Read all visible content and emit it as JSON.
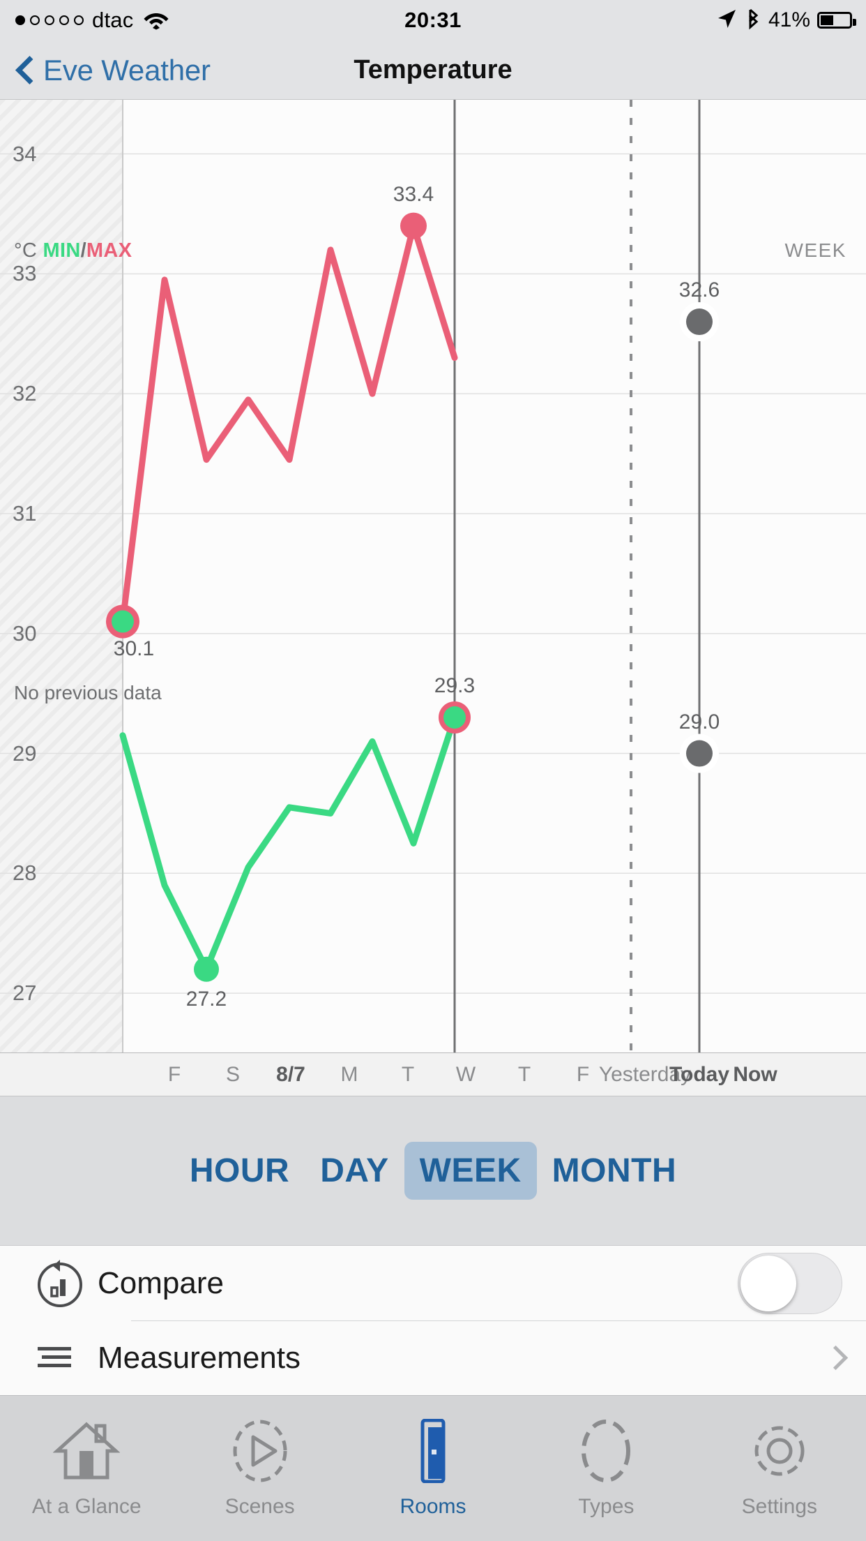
{
  "statusbar": {
    "carrier": "dtac",
    "time": "20:31",
    "battery_pct": "41%",
    "battery_level": 41,
    "signal_filled": 1,
    "signal_total": 5,
    "icons": [
      "wifi-icon",
      "location-arrow-icon",
      "bluetooth-icon",
      "battery-icon"
    ]
  },
  "navbar": {
    "back_label": "Eve Weather",
    "title": "Temperature"
  },
  "chart_header": {
    "unit": "°C",
    "min_label": "MIN",
    "separator": "/",
    "max_label": "MAX",
    "range_badge": "WEEK",
    "no_data_note": "No previous data"
  },
  "chart_data": {
    "type": "line",
    "title": "Temperature",
    "xlabel": "",
    "ylabel": "°C",
    "ylim": [
      26.5,
      34.3
    ],
    "yticks": [
      34,
      33,
      32,
      31,
      30,
      29,
      28,
      27
    ],
    "grid": true,
    "legend_position": "top-left",
    "categories": [
      "F",
      "S",
      "8/7",
      "M",
      "T",
      "W",
      "T",
      "F",
      "Yesterday",
      "Today",
      "Now"
    ],
    "series": [
      {
        "name": "MAX",
        "color": "#ea5f77",
        "values": [
          30.1,
          32.95,
          31.45,
          31.95,
          31.45,
          33.2,
          32.0,
          33.4,
          32.3
        ]
      },
      {
        "name": "MIN",
        "color": "#3ad983",
        "values": [
          29.15,
          27.9,
          27.2,
          28.05,
          28.55,
          28.5,
          29.1,
          28.25,
          29.3
        ]
      }
    ],
    "annotations": [
      {
        "name": "max-peak",
        "label": "33.4",
        "value": 33.4,
        "series": "MAX"
      },
      {
        "name": "min-start",
        "label": "30.1",
        "value": 30.1,
        "series": "MAX"
      },
      {
        "name": "min-low",
        "label": "27.2",
        "value": 27.2,
        "series": "MIN"
      },
      {
        "name": "min-last",
        "label": "29.3",
        "value": 29.3,
        "series": "MIN"
      },
      {
        "name": "now-max",
        "label": "32.6",
        "value": 32.6,
        "series": "NOW-MAX"
      },
      {
        "name": "now-min",
        "label": "29.0",
        "value": 29.0,
        "series": "NOW-MIN"
      }
    ],
    "markers": {
      "today_line": "Today",
      "now_line": "Now",
      "hatched_region_label": "No previous data"
    },
    "colors": {
      "max": "#ea5f77",
      "min": "#3ad983",
      "now_marker": "#6a6b6d",
      "grid": "#e0e0e0",
      "axis_text": "#6d6e70"
    }
  },
  "xaxis_labels": [
    {
      "text": "F",
      "emphasis": false
    },
    {
      "text": "S",
      "emphasis": false
    },
    {
      "text": "8/7",
      "emphasis": true
    },
    {
      "text": "M",
      "emphasis": false
    },
    {
      "text": "T",
      "emphasis": false
    },
    {
      "text": "W",
      "emphasis": false
    },
    {
      "text": "T",
      "emphasis": false
    },
    {
      "text": "F",
      "emphasis": false
    },
    {
      "text": "Yesterday",
      "emphasis": false
    },
    {
      "text": "Today",
      "emphasis": true
    },
    {
      "text": "Now",
      "emphasis": true
    }
  ],
  "segmented": {
    "options": [
      "HOUR",
      "DAY",
      "WEEK",
      "MONTH"
    ],
    "selected": "WEEK",
    "selected_bg": "#a9c0d6",
    "text_color": "#1f6099"
  },
  "rows": [
    {
      "label": "Compare",
      "icon": "compare-chart-icon",
      "control": "toggle",
      "toggle_on": false
    },
    {
      "label": "Measurements",
      "icon": "list-lines-icon",
      "control": "disclosure"
    }
  ],
  "tabbar": {
    "items": [
      {
        "label": "At a Glance",
        "icon": "house-icon",
        "active": false
      },
      {
        "label": "Scenes",
        "icon": "play-circle-icon",
        "active": false
      },
      {
        "label": "Rooms",
        "icon": "door-icon",
        "active": true
      },
      {
        "label": "Types",
        "icon": "dashed-circle-icon",
        "active": false
      },
      {
        "label": "Settings",
        "icon": "gear-icon",
        "active": false
      }
    ],
    "active_color": "#1f6099",
    "inactive_color": "#8a8b8d"
  }
}
